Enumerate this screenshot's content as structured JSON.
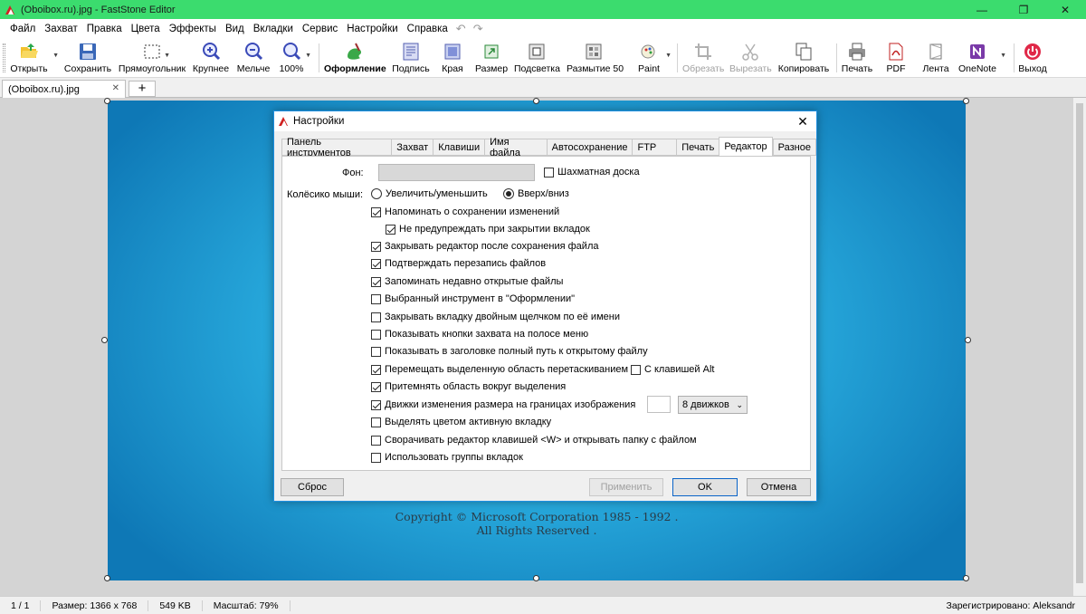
{
  "window": {
    "title": "(Oboibox.ru).jpg - FastStone Editor"
  },
  "menu": [
    "Файл",
    "Захват",
    "Правка",
    "Цвета",
    "Эффекты",
    "Вид",
    "Вкладки",
    "Сервис",
    "Настройки",
    "Справка"
  ],
  "toolbar": {
    "open": "Открыть",
    "save": "Сохранить",
    "rect": "Прямоугольник",
    "zoom_in": "Крупнее",
    "zoom_out": "Мельче",
    "zoom": "100%",
    "draw": "Оформление",
    "caption": "Подпись",
    "edges": "Края",
    "resize": "Размер",
    "highlight": "Подсветка",
    "blur": "Размытие 50",
    "paint": "Paint",
    "crop": "Обрезать",
    "cut": "Вырезать",
    "copy": "Копировать",
    "print": "Печать",
    "pdf": "PDF",
    "ribbon": "Лента",
    "onenote": "OneNote",
    "exit": "Выход"
  },
  "tabs": {
    "doc": "(Oboibox.ru).jpg",
    "add": "+"
  },
  "wallpaper": {
    "copyright_line1": "Copyright © Microsoft Corporation 1985 - 1992 .",
    "copyright_line2": "All Rights Reserved ."
  },
  "dialog": {
    "title": "Настройки",
    "tabs": [
      "Панель инструментов",
      "Захват",
      "Клавиши",
      "Имя файла",
      "Автосохранение",
      "FTP",
      "Печать",
      "Редактор",
      "Разное"
    ],
    "active_tab": "Редактор",
    "bg_label": "Фон:",
    "checker_label": "Шахматная доска",
    "wheel_label": "Колёсико мыши:",
    "wheel_zoom": "Увеличить/уменьшить",
    "wheel_scroll": "Вверх/вниз",
    "options": [
      {
        "label": "Напоминать о сохранении изменений",
        "checked": true
      },
      {
        "label": "Не предупреждать при закрытии вкладок",
        "checked": true
      },
      {
        "label": "Закрывать редактор после сохранения файла",
        "checked": true
      },
      {
        "label": "Подтверждать перезапись файлов",
        "checked": true
      },
      {
        "label": "Запоминать недавно открытые файлы",
        "checked": true
      },
      {
        "label": "Выбранный инструмент в \"Оформлении\"",
        "checked": false
      },
      {
        "label": "Закрывать вкладку двойным щелчком по её имени",
        "checked": false
      },
      {
        "label": "Показывать кнопки захвата на полосе меню",
        "checked": false
      },
      {
        "label": "Показывать в заголовке полный путь к открытому файлу",
        "checked": false
      },
      {
        "label": "Перемещать выделенную область перетаскиванием",
        "checked": true
      },
      {
        "label": "Притемнять область вокруг выделения",
        "checked": true
      },
      {
        "label": "Движки изменения размера на границах изображения",
        "checked": true
      },
      {
        "label": "Выделять цветом активную вкладку",
        "checked": false
      },
      {
        "label": "Сворачивать редактор клавишей <W> и открывать папку с файлом",
        "checked": false
      },
      {
        "label": "Использовать группы вкладок",
        "checked": false
      }
    ],
    "alt_label": "С клавишей Alt",
    "handles_select": "8 движков",
    "btn_reset": "Сброс",
    "btn_apply": "Применить",
    "btn_ok": "OK",
    "btn_cancel": "Отмена"
  },
  "status": {
    "page": "1 / 1",
    "size": "Размер: 1366 x 768",
    "filesize": "549 KB",
    "zoom": "Масштаб: 79%",
    "registered": "Зарегистрировано: Aleksandr"
  }
}
